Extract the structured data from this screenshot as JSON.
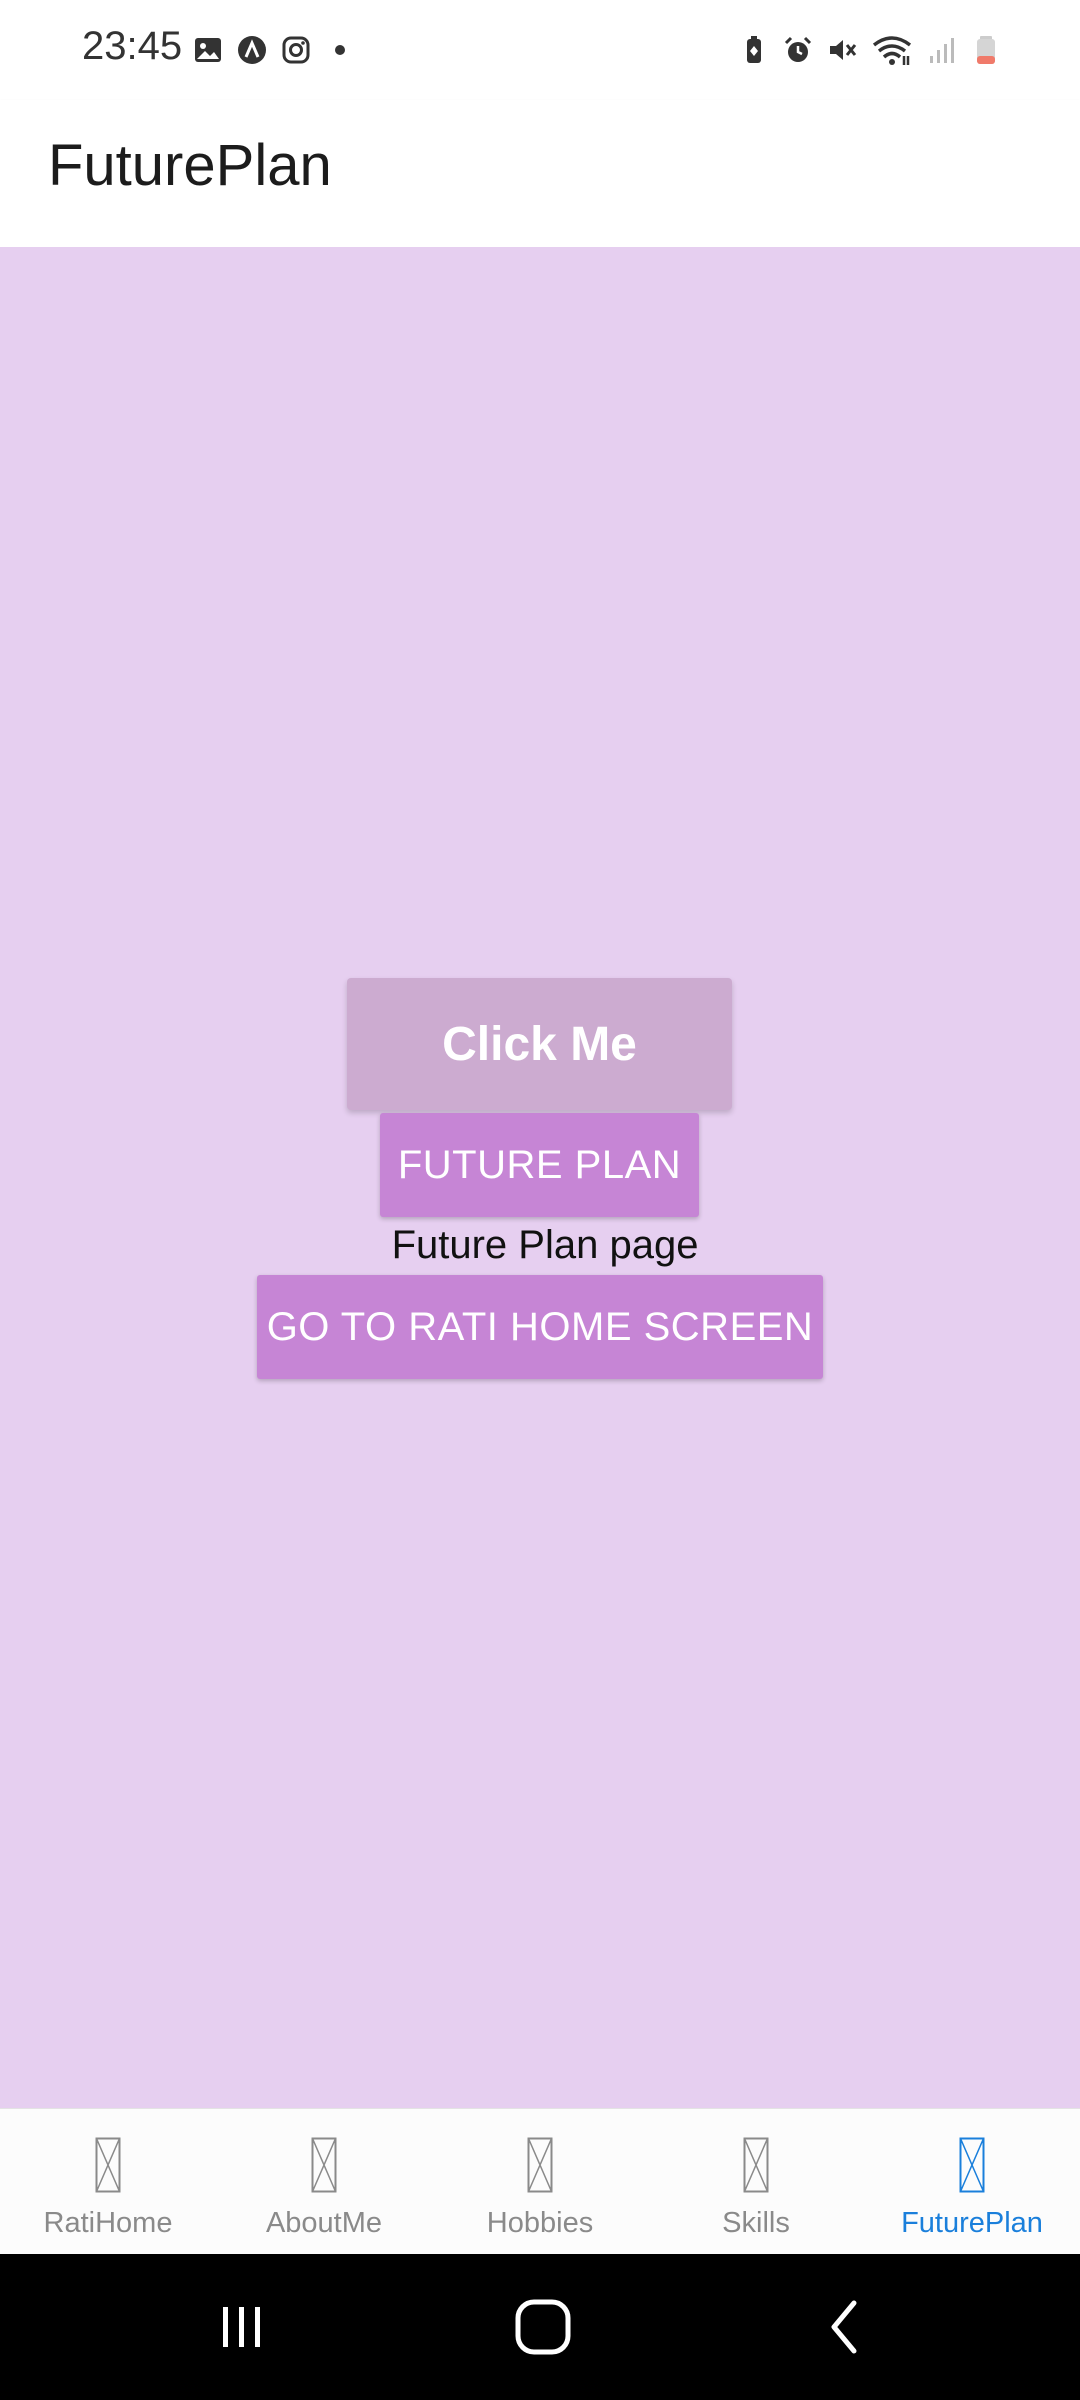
{
  "status_bar": {
    "time": "23:45",
    "left_icons": [
      "gallery-icon",
      "a-notification-icon",
      "instagram-icon",
      "dot-icon"
    ],
    "right_icons": [
      "battery-saver-icon",
      "alarm-icon",
      "mute-icon",
      "wifi-icon",
      "signal-icon",
      "battery-low-icon"
    ]
  },
  "header": {
    "title": "FuturePlan"
  },
  "main": {
    "click_me_label": "Click Me",
    "future_plan_label": "FUTURE PLAN",
    "caption": "Future Plan page",
    "go_home_label": "GO TO RATI HOME SCREEN"
  },
  "tabs": [
    {
      "label": "RatiHome",
      "icon": "missing-glyph-icon",
      "active": false
    },
    {
      "label": "AboutMe",
      "icon": "missing-glyph-icon",
      "active": false
    },
    {
      "label": "Hobbies",
      "icon": "missing-glyph-icon",
      "active": false
    },
    {
      "label": "Skills",
      "icon": "missing-glyph-icon",
      "active": false
    },
    {
      "label": "FuturePlan",
      "icon": "missing-glyph-icon",
      "active": true
    }
  ],
  "colors": {
    "content_bg": "#e6cff0",
    "button_primary": "#c685d5",
    "button_disabled": "#ccabd0",
    "tab_active": "#1a7fdb",
    "tab_inactive": "#8a8a8a"
  },
  "nav_bar": {
    "buttons": [
      "recents-icon",
      "home-icon",
      "back-icon"
    ]
  }
}
